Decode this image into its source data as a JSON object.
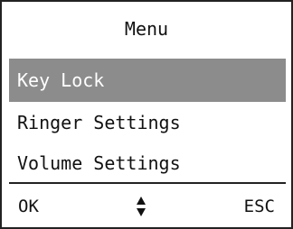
{
  "screen": {
    "title": "Menu",
    "items": [
      {
        "label": "Key Lock",
        "selected": true
      },
      {
        "label": "Ringer Settings",
        "selected": false
      },
      {
        "label": "Volume Settings",
        "selected": false
      }
    ]
  },
  "softkeys": {
    "left_label": "OK",
    "center_icon": "up-down-arrows-icon",
    "right_label": "ESC"
  },
  "colors": {
    "selection_background": "#8c8c8c",
    "selection_text": "#ffffff",
    "text": "#111111",
    "border": "#222222"
  }
}
